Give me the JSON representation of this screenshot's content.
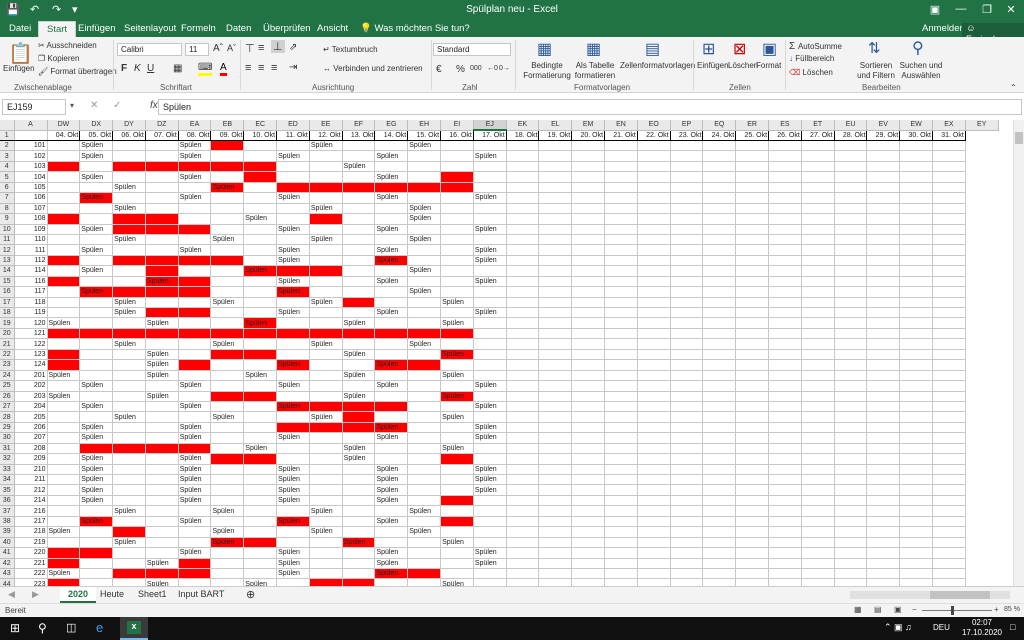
{
  "window": {
    "title": "Spülplan neu - Excel",
    "user": "Anmelden",
    "share": "Freigeben",
    "search": "Was möchten Sie tun?"
  },
  "tabs": [
    "Datei",
    "Start",
    "Einfügen",
    "Seitenlayout",
    "Formeln",
    "Daten",
    "Überprüfen",
    "Ansicht"
  ],
  "ribbon": {
    "paste": "Einfügen",
    "cut": "Ausschneiden",
    "copy": "Kopieren",
    "format_painter": "Format übertragen",
    "clipboard": "Zwischenablage",
    "font": "Calibri",
    "size": "11",
    "font_group": "Schriftart",
    "wrap": "Textumbruch",
    "merge": "Verbinden und zentrieren",
    "align_group": "Ausrichtung",
    "numfmt": "Standard",
    "percent": "%",
    "thousands": "000",
    "number_group": "Zahl",
    "cond": "Bedingte Formatierung",
    "astable": "Als Tabelle formatieren",
    "cellstyles": "Zellenformatvorlagen",
    "styles_group": "Formatvorlagen",
    "insert": "Einfügen",
    "delete": "Löschen",
    "format": "Format",
    "cells_group": "Zellen",
    "autosum": "AutoSumme",
    "fill": "Füllbereich",
    "clear": "Löschen",
    "sort": "Sortieren und Filtern",
    "find": "Suchen und Auswählen",
    "edit_group": "Bearbeiten"
  },
  "namebox": "EJ159",
  "formula": "Spülen",
  "columns": [
    "A",
    "DW",
    "DX",
    "DY",
    "DZ",
    "EA",
    "EB",
    "EC",
    "ED",
    "EE",
    "EF",
    "EG",
    "EH",
    "EI",
    "EJ",
    "EK",
    "EL",
    "EM",
    "EN",
    "EO",
    "EP",
    "EQ",
    "ER",
    "ES",
    "ET",
    "EU",
    "EV",
    "EW",
    "EX",
    "EY"
  ],
  "selected_column": "EJ",
  "dates": [
    "04. Okt",
    "05. Okt",
    "06. Okt",
    "07. Okt",
    "08. Okt",
    "09. Okt",
    "10. Okt",
    "11. Okt",
    "12. Okt",
    "13. Okt",
    "14. Okt",
    "15. Okt",
    "16. Okt",
    "17. Okt",
    "18. Okt",
    "19. Okt",
    "20. Okt",
    "21. Okt",
    "22. Okt",
    "23. Okt",
    "24. Okt",
    "25. Okt",
    "26. Okt",
    "27. Okt",
    "28. Okt",
    "29. Okt",
    "30. Okt",
    "31. Okt"
  ],
  "rows": [
    {
      "n": "2",
      "id": "101",
      "c": "_ S _ _ S R _ _ S _ _ S _ _"
    },
    {
      "n": "3",
      "id": "102",
      "c": "_ S _ _ S _ _ S _ _ S _ _ S"
    },
    {
      "n": "4",
      "id": "103",
      "c": "R _ R R R R R _ _ S _ _ _ _"
    },
    {
      "n": "5",
      "id": "104",
      "c": "_ S _ _ S _ R _ _ _ S _ R _"
    },
    {
      "n": "6",
      "id": "105",
      "c": "_ _ S _ _ X _ R R R R R R _"
    },
    {
      "n": "7",
      "id": "106",
      "c": "_ X _ _ S _ _ S _ _ S _ _ S"
    },
    {
      "n": "8",
      "id": "107",
      "c": "_ _ S _ _ _ _ _ S _ _ S _ _"
    },
    {
      "n": "9",
      "id": "108",
      "c": "R _ R R _ _ S _ R _ _ S _ _"
    },
    {
      "n": "10",
      "id": "109",
      "c": "_ S R R R _ _ S _ _ S _ _ S"
    },
    {
      "n": "11",
      "id": "110",
      "c": "_ _ S _ _ S _ _ S _ _ S _ _"
    },
    {
      "n": "12",
      "id": "111",
      "c": "_ S _ _ S _ _ S _ _ S _ _ S"
    },
    {
      "n": "13",
      "id": "112",
      "c": "R _ R R R R _ S _ _ X _ _ S"
    },
    {
      "n": "14",
      "id": "114",
      "c": "_ S _ R _ _ X R R _ _ S _ _"
    },
    {
      "n": "15",
      "id": "116",
      "c": "R _ _ X R _ _ S _ _ S _ _ S"
    },
    {
      "n": "16",
      "id": "117",
      "c": "_ X R R R _ _ X _ _ _ S _ _"
    },
    {
      "n": "17",
      "id": "118",
      "c": "_ _ S _ _ S _ _ S R _ _ S _"
    },
    {
      "n": "18",
      "id": "119",
      "c": "_ _ S R R _ _ S _ _ S _ _ S"
    },
    {
      "n": "19",
      "id": "120",
      "c": "S _ _ S _ _ X _ _ S _ _ S _"
    },
    {
      "n": "20",
      "id": "121",
      "c": "R R R R R R R R R R R R R _"
    },
    {
      "n": "21",
      "id": "122",
      "c": "_ _ S _ _ S _ _ S _ _ S _ _"
    },
    {
      "n": "22",
      "id": "123",
      "c": "R _ _ S _ R R _ _ S _ _ X _"
    },
    {
      "n": "23",
      "id": "124",
      "c": "R _ _ S R _ _ X _ _ X R _ _"
    },
    {
      "n": "24",
      "id": "201",
      "c": "S _ _ S _ _ S _ _ S _ _ S _"
    },
    {
      "n": "25",
      "id": "202",
      "c": "_ S _ _ S _ _ S _ _ S _ _ S"
    },
    {
      "n": "26",
      "id": "203",
      "c": "S _ _ S _ R R _ _ S _ _ X _"
    },
    {
      "n": "27",
      "id": "204",
      "c": "_ S _ _ S _ _ X R R R _ _ S"
    },
    {
      "n": "28",
      "id": "205",
      "c": "_ _ S _ _ S _ _ S R _ _ S _"
    },
    {
      "n": "29",
      "id": "206",
      "c": "_ S _ _ S _ _ R R R X _ _ S"
    },
    {
      "n": "30",
      "id": "207",
      "c": "_ S _ _ S _ _ S _ _ S _ _ S"
    },
    {
      "n": "31",
      "id": "208",
      "c": "_ R R R R _ S _ _ S _ _ S _"
    },
    {
      "n": "32",
      "id": "209",
      "c": "_ S _ _ S R R _ _ S _ _ R _"
    },
    {
      "n": "33",
      "id": "210",
      "c": "_ S _ _ S _ _ S _ _ S _ _ S"
    },
    {
      "n": "34",
      "id": "211",
      "c": "_ S _ _ S _ _ S _ _ S _ _ S"
    },
    {
      "n": "35",
      "id": "212",
      "c": "_ S _ _ S _ _ S _ _ S _ _ S"
    },
    {
      "n": "36",
      "id": "214",
      "c": "_ S _ _ S _ _ S _ _ S _ R _"
    },
    {
      "n": "37",
      "id": "216",
      "c": "_ _ S _ _ S _ _ S _ _ S _ _"
    },
    {
      "n": "38",
      "id": "217",
      "c": "_ X _ _ S _ _ X _ _ S _ R _"
    },
    {
      "n": "39",
      "id": "218",
      "c": "S _ R _ _ S _ _ S _ _ S _ _"
    },
    {
      "n": "40",
      "id": "219",
      "c": "_ _ S _ _ X R _ _ X _ _ S _"
    },
    {
      "n": "41",
      "id": "220",
      "c": "R R _ _ S _ _ S _ _ S _ _ S"
    },
    {
      "n": "42",
      "id": "221",
      "c": "R _ _ S R _ _ S _ _ S _ _ S"
    },
    {
      "n": "43",
      "id": "222",
      "c": "S _ R R R _ _ S _ _ X R _ _"
    },
    {
      "n": "44",
      "id": "223",
      "c": "R _ _ S _ _ S _ R R _ _ S _"
    }
  ],
  "cell_text": "Spülen",
  "sheets": [
    "2020",
    "Heute",
    "Sheet1",
    "Input BART"
  ],
  "status": {
    "ready": "Bereit",
    "zoom": "85 %"
  },
  "taskbar": {
    "time": "02:07",
    "date": "17.10.2020",
    "lang": "DEU"
  },
  "colors": {
    "excel_green": "#217346",
    "fill_red": "#ff0000"
  }
}
